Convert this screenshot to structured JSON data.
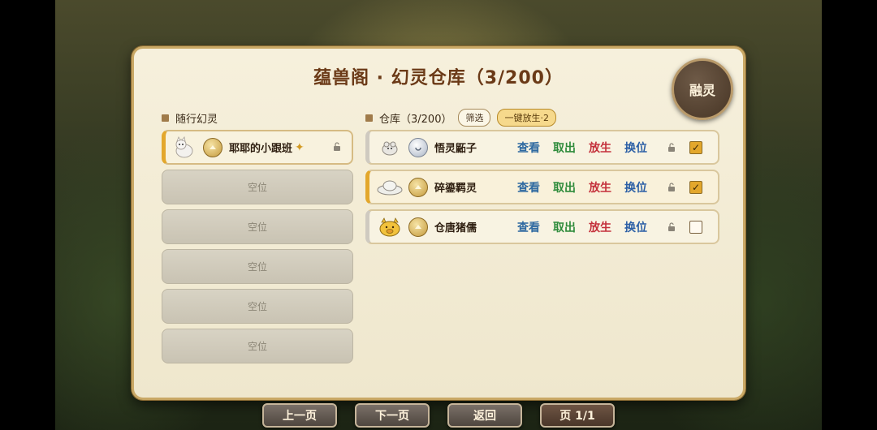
{
  "title": "蕴兽阁 · 幻灵仓库（3/200）",
  "fuse_button": "融灵",
  "follow": {
    "heading": "随行幻灵",
    "active": {
      "name": "耶耶的小跟班",
      "sparkle": "✦",
      "icon": "white-cat-icon",
      "rank": "gold-rank-icon"
    },
    "empty_label": "空位",
    "empty_slots": [
      "空位",
      "空位",
      "空位",
      "空位",
      "空位"
    ]
  },
  "storage": {
    "heading": "仓库（3/200）",
    "filter_label": "筛选",
    "release_all_label": "一键放生·2",
    "actions": {
      "view": "查看",
      "take": "取出",
      "free": "放生",
      "swap": "换位"
    },
    "items": [
      {
        "name": "悟灵鼫子",
        "icon": "rodent-icon",
        "rank": "silver-rank-icon",
        "checked": true,
        "highlight": false
      },
      {
        "name": "碎鎏羁灵",
        "icon": "cloud-spirit-icon",
        "rank": "gold-rank-icon",
        "checked": true,
        "highlight": true
      },
      {
        "name": "仓唐猪儒",
        "icon": "golden-pig-icon",
        "rank": "gold-rank-icon",
        "checked": false,
        "highlight": false
      }
    ]
  },
  "bottom": {
    "prev": "上一页",
    "next": "下一页",
    "back": "返回",
    "page": "页 1/1"
  },
  "colors": {
    "accent": "#e3a72c",
    "title": "#6b3a17",
    "view": "#2f6aa1",
    "take": "#2f8c3c",
    "free": "#c4303b"
  }
}
